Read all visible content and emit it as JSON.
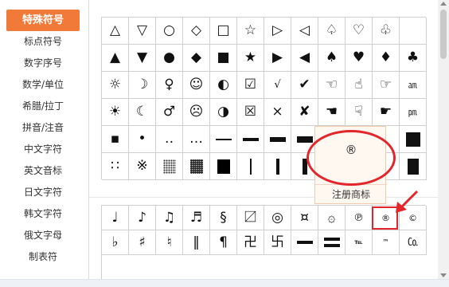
{
  "sidebar": {
    "items": [
      {
        "label": "特殊符号",
        "active": true
      },
      {
        "label": "标点符号"
      },
      {
        "label": "数字序号"
      },
      {
        "label": "数学/单位"
      },
      {
        "label": "希腊/拉丁"
      },
      {
        "label": "拼音/注音"
      },
      {
        "label": "中文字符"
      },
      {
        "label": "英文音标"
      },
      {
        "label": "日文字符"
      },
      {
        "label": "韩文字符"
      },
      {
        "label": "俄文字母"
      },
      {
        "label": "制表符"
      }
    ]
  },
  "grid1": [
    [
      "△",
      "▽",
      "○",
      "◇",
      "□",
      "☆",
      "▷",
      "◁",
      "♤",
      "♡",
      "♧"
    ],
    [
      "▲",
      "▼",
      "●",
      "◆",
      "■",
      "★",
      "▶",
      "◀",
      "♠",
      "♥",
      "♦",
      "♣"
    ],
    [
      "☼",
      "☽",
      "♀",
      "☺",
      "◐",
      "☑",
      "√",
      "✔",
      "☜",
      "☝",
      "☞",
      "㏂"
    ],
    [
      "☀",
      "☾",
      "♂",
      "☹",
      "◑",
      "☒",
      "×",
      "✘",
      "☚",
      "☟",
      "☛",
      "㏘"
    ],
    [
      "▪",
      "•",
      "‥",
      "…",
      "",
      "",
      "",
      "",
      "",
      "",
      "",
      ""
    ],
    [
      "∷",
      "※",
      "",
      "",
      "",
      "",
      "",
      "",
      "",
      "",
      "",
      ""
    ]
  ],
  "grid2": [
    [
      "♩",
      "♪",
      "♫",
      "♬",
      "§",
      "〼",
      "◎",
      "¤",
      "۞",
      "℗",
      "®",
      "©"
    ],
    [
      "♭",
      "♯",
      "♮",
      "‖",
      "¶",
      "卍",
      "卐",
      "",
      "",
      "℡",
      "™",
      "㏇"
    ]
  ],
  "popup": {
    "symbol": "®",
    "label": "注册商标"
  },
  "colors": {
    "accent": "#f27a39",
    "highlight": "#e2262b"
  }
}
